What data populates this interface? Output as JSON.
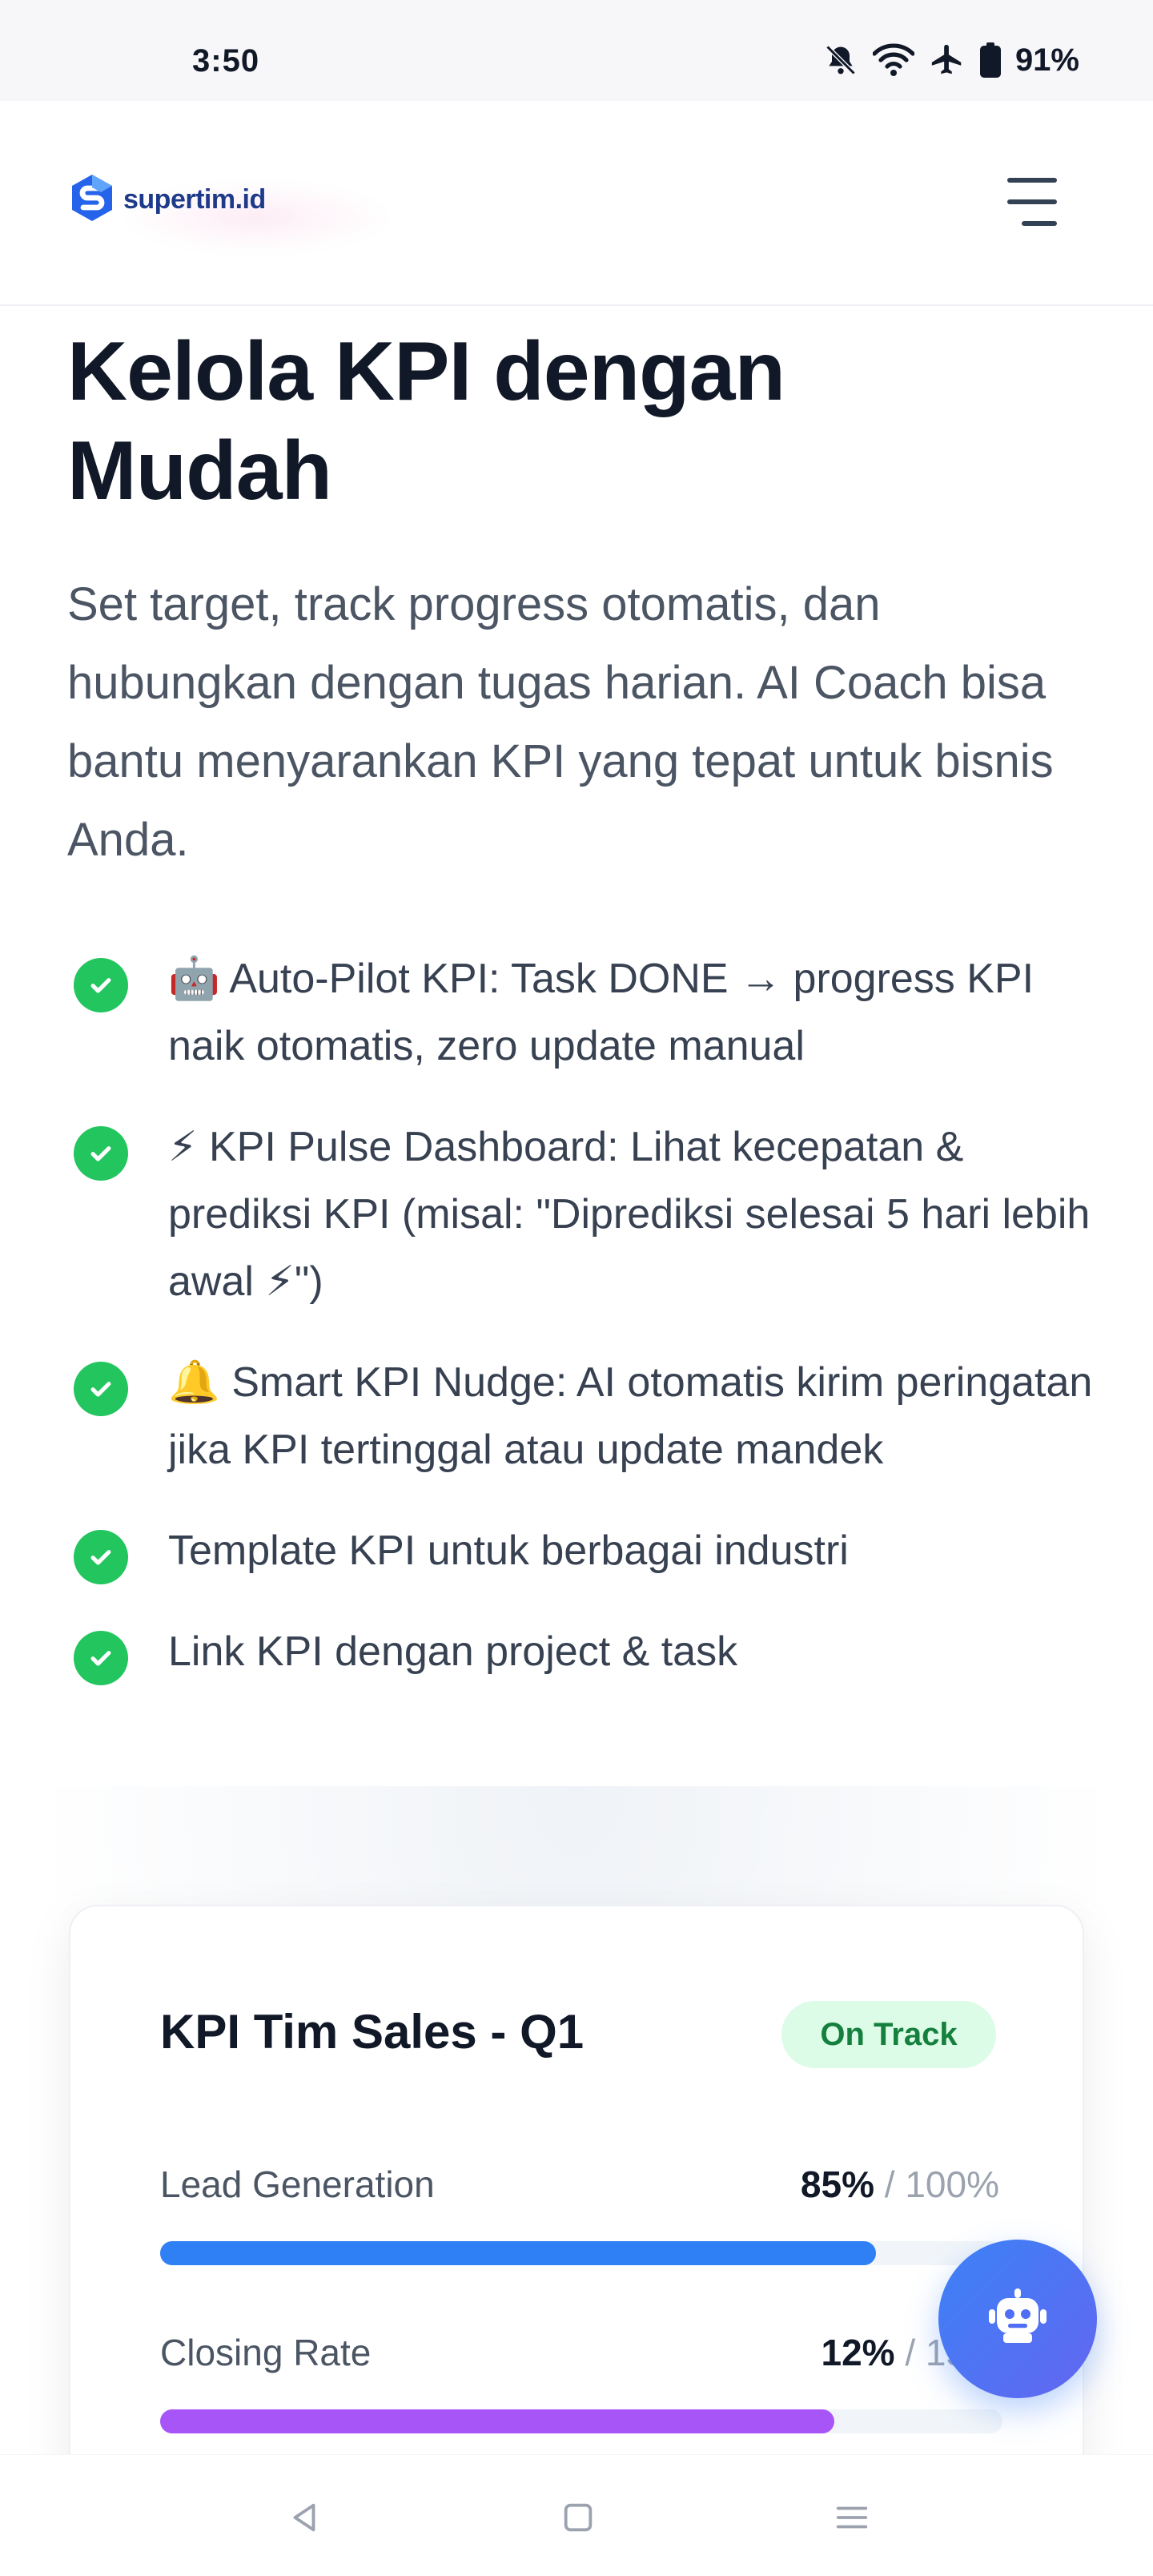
{
  "status_bar": {
    "time": "3:50",
    "battery": "91%",
    "icons": [
      "bell-muted-icon",
      "wifi-icon",
      "airplane-icon",
      "battery-icon"
    ]
  },
  "header": {
    "logo_text": "supertim.id",
    "menu_icon": "hamburger-menu-icon"
  },
  "hero": {
    "title": "Kelola KPI dengan Mudah",
    "subtitle": "Set target, track progress otomatis, dan hubungkan dengan tugas harian. AI Coach bisa bantu menyarankan KPI yang tepat untuk bisnis Anda."
  },
  "features": [
    {
      "text": "🤖 Auto-Pilot KPI: Task DONE → progress KPI naik otomatis, zero update manual"
    },
    {
      "text": "⚡ KPI Pulse Dashboard: Lihat kecepatan & prediksi KPI (misal: \"Diprediksi selesai 5 hari lebih awal ⚡\")"
    },
    {
      "text": "🔔 Smart KPI Nudge: AI otomatis kirim peringatan jika KPI tertinggal atau update mandek"
    },
    {
      "text": "Template KPI untuk berbagai industri"
    },
    {
      "text": "Link KPI dengan project & task"
    }
  ],
  "kpi_card": {
    "title": "KPI Tim Sales - Q1",
    "status": "On Track",
    "rows": [
      {
        "label": "Lead Generation",
        "value": "85%",
        "target": "/ 100%",
        "fraction": 0.85,
        "color": "#2f7ff5"
      },
      {
        "label": "Closing Rate",
        "value": "12%",
        "target": "/ 15%",
        "fraction": 0.8,
        "color": "#a855f7"
      }
    ]
  },
  "fab": {
    "icon": "ai-robot-icon"
  },
  "nav_bar": {
    "icons": [
      "back-icon",
      "home-icon",
      "recents-icon"
    ]
  },
  "colors": {
    "accent": "#3b82f6",
    "success": "#22c55e",
    "badge_bg": "#dcfce7",
    "badge_text": "#15803d"
  }
}
